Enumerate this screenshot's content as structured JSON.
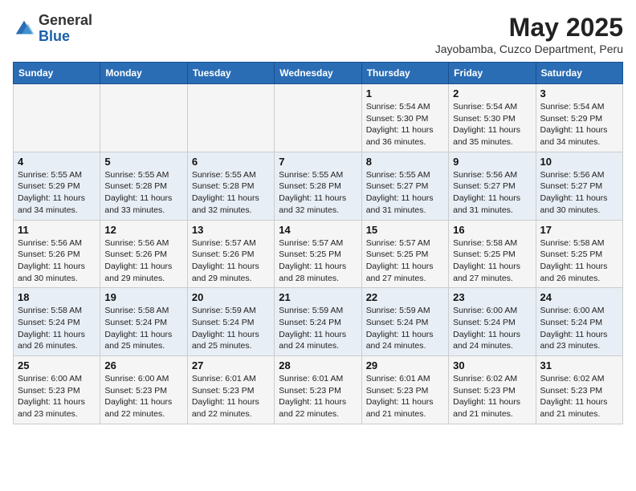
{
  "header": {
    "logo_general": "General",
    "logo_blue": "Blue",
    "month_title": "May 2025",
    "location": "Jayobamba, Cuzco Department, Peru"
  },
  "days_of_week": [
    "Sunday",
    "Monday",
    "Tuesday",
    "Wednesday",
    "Thursday",
    "Friday",
    "Saturday"
  ],
  "weeks": [
    [
      {
        "day": "",
        "info": ""
      },
      {
        "day": "",
        "info": ""
      },
      {
        "day": "",
        "info": ""
      },
      {
        "day": "",
        "info": ""
      },
      {
        "day": "1",
        "info": "Sunrise: 5:54 AM\nSunset: 5:30 PM\nDaylight: 11 hours\nand 36 minutes."
      },
      {
        "day": "2",
        "info": "Sunrise: 5:54 AM\nSunset: 5:30 PM\nDaylight: 11 hours\nand 35 minutes."
      },
      {
        "day": "3",
        "info": "Sunrise: 5:54 AM\nSunset: 5:29 PM\nDaylight: 11 hours\nand 34 minutes."
      }
    ],
    [
      {
        "day": "4",
        "info": "Sunrise: 5:55 AM\nSunset: 5:29 PM\nDaylight: 11 hours\nand 34 minutes."
      },
      {
        "day": "5",
        "info": "Sunrise: 5:55 AM\nSunset: 5:28 PM\nDaylight: 11 hours\nand 33 minutes."
      },
      {
        "day": "6",
        "info": "Sunrise: 5:55 AM\nSunset: 5:28 PM\nDaylight: 11 hours\nand 32 minutes."
      },
      {
        "day": "7",
        "info": "Sunrise: 5:55 AM\nSunset: 5:28 PM\nDaylight: 11 hours\nand 32 minutes."
      },
      {
        "day": "8",
        "info": "Sunrise: 5:55 AM\nSunset: 5:27 PM\nDaylight: 11 hours\nand 31 minutes."
      },
      {
        "day": "9",
        "info": "Sunrise: 5:56 AM\nSunset: 5:27 PM\nDaylight: 11 hours\nand 31 minutes."
      },
      {
        "day": "10",
        "info": "Sunrise: 5:56 AM\nSunset: 5:27 PM\nDaylight: 11 hours\nand 30 minutes."
      }
    ],
    [
      {
        "day": "11",
        "info": "Sunrise: 5:56 AM\nSunset: 5:26 PM\nDaylight: 11 hours\nand 30 minutes."
      },
      {
        "day": "12",
        "info": "Sunrise: 5:56 AM\nSunset: 5:26 PM\nDaylight: 11 hours\nand 29 minutes."
      },
      {
        "day": "13",
        "info": "Sunrise: 5:57 AM\nSunset: 5:26 PM\nDaylight: 11 hours\nand 29 minutes."
      },
      {
        "day": "14",
        "info": "Sunrise: 5:57 AM\nSunset: 5:25 PM\nDaylight: 11 hours\nand 28 minutes."
      },
      {
        "day": "15",
        "info": "Sunrise: 5:57 AM\nSunset: 5:25 PM\nDaylight: 11 hours\nand 27 minutes."
      },
      {
        "day": "16",
        "info": "Sunrise: 5:58 AM\nSunset: 5:25 PM\nDaylight: 11 hours\nand 27 minutes."
      },
      {
        "day": "17",
        "info": "Sunrise: 5:58 AM\nSunset: 5:25 PM\nDaylight: 11 hours\nand 26 minutes."
      }
    ],
    [
      {
        "day": "18",
        "info": "Sunrise: 5:58 AM\nSunset: 5:24 PM\nDaylight: 11 hours\nand 26 minutes."
      },
      {
        "day": "19",
        "info": "Sunrise: 5:58 AM\nSunset: 5:24 PM\nDaylight: 11 hours\nand 25 minutes."
      },
      {
        "day": "20",
        "info": "Sunrise: 5:59 AM\nSunset: 5:24 PM\nDaylight: 11 hours\nand 25 minutes."
      },
      {
        "day": "21",
        "info": "Sunrise: 5:59 AM\nSunset: 5:24 PM\nDaylight: 11 hours\nand 24 minutes."
      },
      {
        "day": "22",
        "info": "Sunrise: 5:59 AM\nSunset: 5:24 PM\nDaylight: 11 hours\nand 24 minutes."
      },
      {
        "day": "23",
        "info": "Sunrise: 6:00 AM\nSunset: 5:24 PM\nDaylight: 11 hours\nand 24 minutes."
      },
      {
        "day": "24",
        "info": "Sunrise: 6:00 AM\nSunset: 5:24 PM\nDaylight: 11 hours\nand 23 minutes."
      }
    ],
    [
      {
        "day": "25",
        "info": "Sunrise: 6:00 AM\nSunset: 5:23 PM\nDaylight: 11 hours\nand 23 minutes."
      },
      {
        "day": "26",
        "info": "Sunrise: 6:00 AM\nSunset: 5:23 PM\nDaylight: 11 hours\nand 22 minutes."
      },
      {
        "day": "27",
        "info": "Sunrise: 6:01 AM\nSunset: 5:23 PM\nDaylight: 11 hours\nand 22 minutes."
      },
      {
        "day": "28",
        "info": "Sunrise: 6:01 AM\nSunset: 5:23 PM\nDaylight: 11 hours\nand 22 minutes."
      },
      {
        "day": "29",
        "info": "Sunrise: 6:01 AM\nSunset: 5:23 PM\nDaylight: 11 hours\nand 21 minutes."
      },
      {
        "day": "30",
        "info": "Sunrise: 6:02 AM\nSunset: 5:23 PM\nDaylight: 11 hours\nand 21 minutes."
      },
      {
        "day": "31",
        "info": "Sunrise: 6:02 AM\nSunset: 5:23 PM\nDaylight: 11 hours\nand 21 minutes."
      }
    ]
  ]
}
